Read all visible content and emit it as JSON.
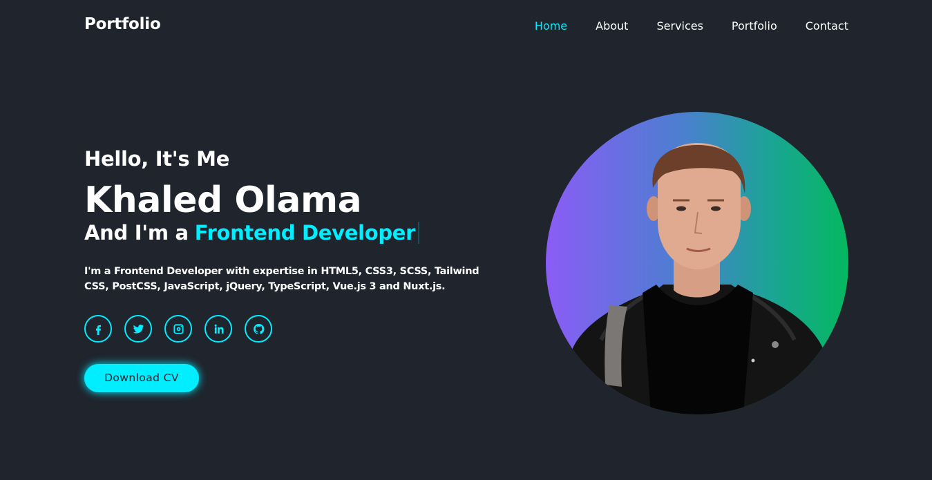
{
  "header": {
    "logo": "Portfolio",
    "nav": [
      "Home",
      "About",
      "Services",
      "Portfolio",
      "Contact"
    ],
    "active": "Home"
  },
  "hero": {
    "greeting": "Hello, It's Me",
    "name": "Khaled Olama",
    "role_prefix": "And I'm a",
    "role": "Frontend Developer",
    "description": "I'm a Frontend Developer with expertise in HTML5, CSS3, SCSS, Tailwind CSS, PostCSS, JavaScript, jQuery, TypeScript, Vue.js 3 and Nuxt.js.",
    "socials": [
      "facebook-icon",
      "twitter-icon",
      "instagram-icon",
      "linkedin-icon",
      "github-icon"
    ],
    "cta_label": "Download CV"
  },
  "colors": {
    "background": "#1f242d",
    "accent": "#00eeff",
    "text": "#ffffff"
  }
}
